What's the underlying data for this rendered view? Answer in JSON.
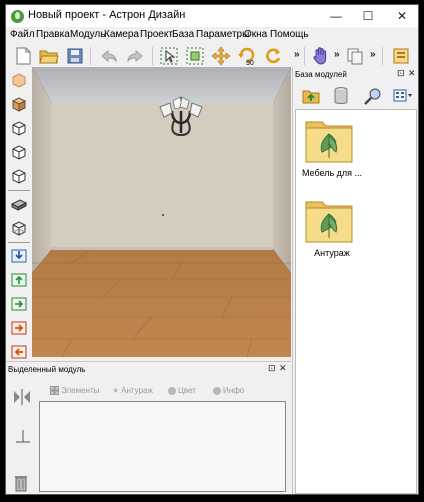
{
  "window": {
    "title": "Новый проект - Астрон Дизайн",
    "controls": {
      "minimize": "—",
      "maximize": "☐",
      "close": "✕"
    }
  },
  "menu": [
    "Файл",
    "Правка",
    "Модуль",
    "Камера",
    "Проект",
    "База",
    "Параметры",
    "Окна",
    "Помощь"
  ],
  "toolbar": {
    "overflow": "»",
    "buttons": [
      "new-file",
      "open-folder",
      "save",
      "undo",
      "redo",
      "select",
      "scale-frame",
      "move",
      "rotate-90",
      "rotate",
      "hand",
      "copy",
      "catalog"
    ],
    "rotate_label": "90"
  },
  "left_tools": [
    "cube-orange",
    "cube-1",
    "cube-2",
    "cube-3",
    "cube-4",
    "slab",
    "box-wire",
    "import",
    "upload",
    "export-green",
    "move-right-red",
    "move-left-red"
  ],
  "viewport": {
    "wall_color": "#d5ccc0",
    "floor_color": "#b07038",
    "ceiling_color": "#c3c3c6"
  },
  "selected_module_panel": {
    "title": "Выделенный модуль",
    "controls": {
      "pin": "⊡",
      "close": "✕"
    },
    "tabs": [
      "Элементы",
      "Антураж",
      "Цвет",
      "Инфо"
    ]
  },
  "module_base_panel": {
    "title": "База модулей",
    "controls": {
      "pin": "⊡",
      "close": "✕"
    },
    "folders": [
      {
        "label": "Мебель для ..."
      },
      {
        "label": "Антураж"
      }
    ]
  }
}
